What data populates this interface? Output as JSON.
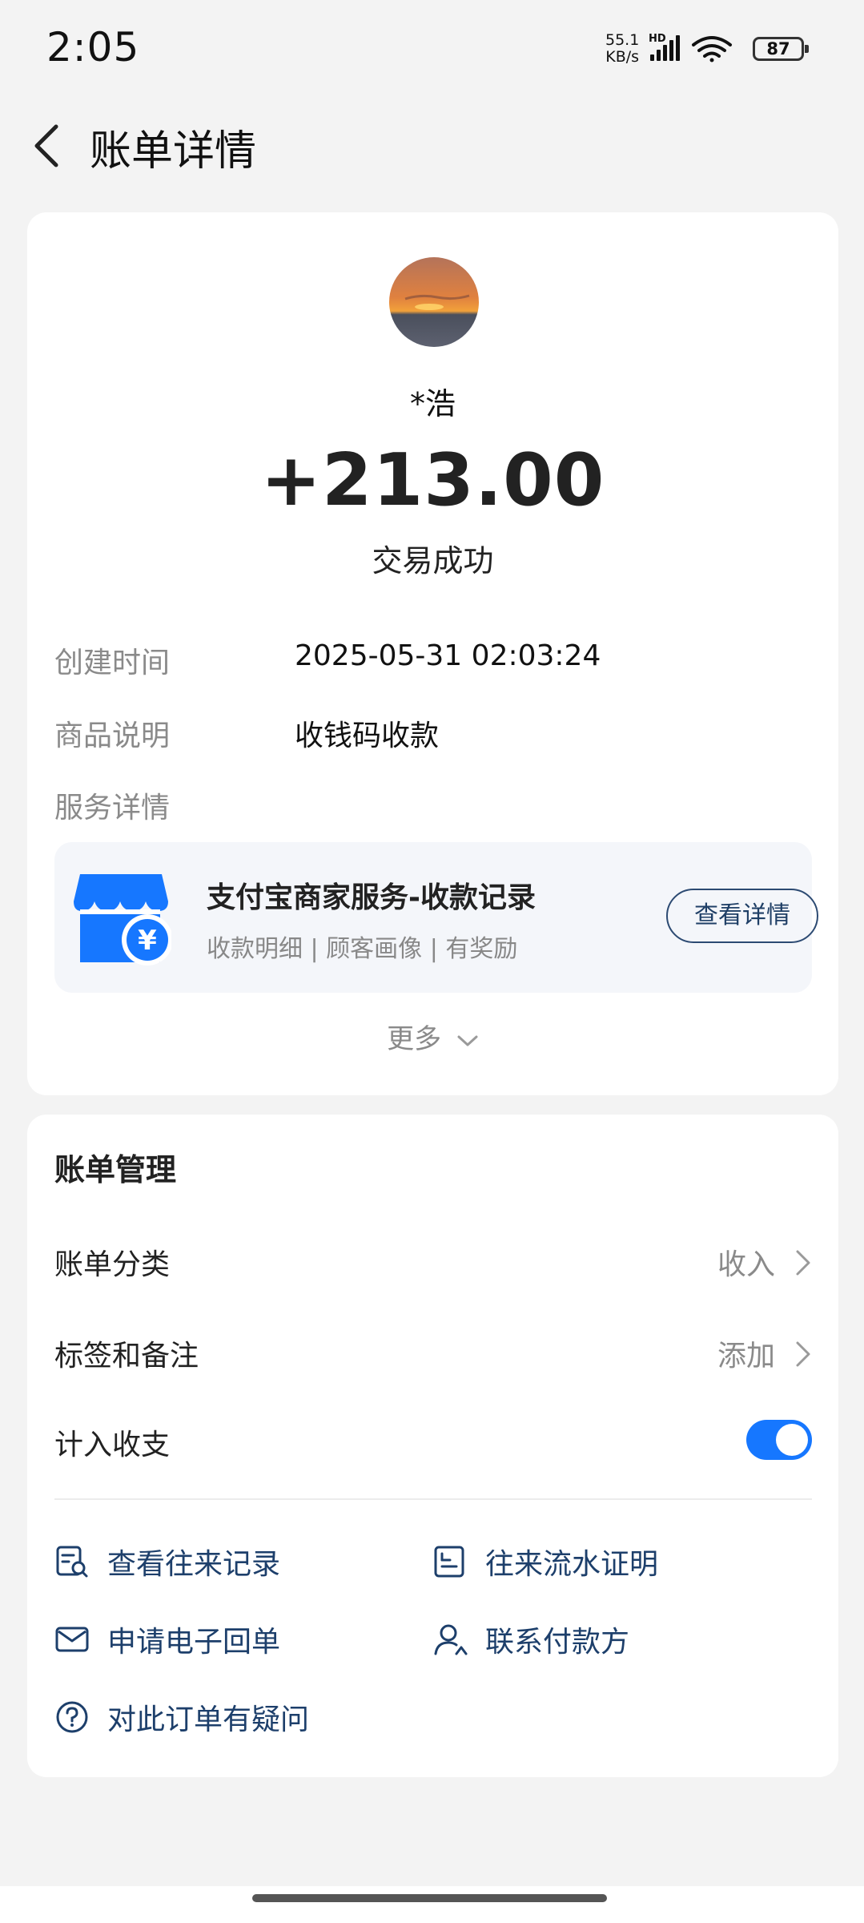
{
  "status_bar": {
    "time": "2:05",
    "net_speed_value": "55.1",
    "net_speed_unit": "KB/s",
    "network_badge": "HD",
    "battery_level": "87"
  },
  "header": {
    "title": "账单详情"
  },
  "transaction": {
    "payer_name": "*浩",
    "amount": "+213.00",
    "status": "交易成功"
  },
  "details": [
    {
      "label": "创建时间",
      "value": "2025-05-31 02:03:24"
    },
    {
      "label": "商品说明",
      "value": "收钱码收款"
    },
    {
      "label": "服务详情",
      "value": ""
    }
  ],
  "service": {
    "title": "支付宝商家服务-收款记录",
    "subtitle": "收款明细 | 顾客画像 | 有奖励",
    "button_label": "查看详情"
  },
  "more": {
    "label": "更多"
  },
  "bill_management": {
    "title": "账单管理",
    "category": {
      "label": "账单分类",
      "value": "收入"
    },
    "tags_notes": {
      "label": "标签和备注",
      "value": "添加"
    },
    "include_income_expense": {
      "label": "计入收支",
      "enabled": true
    }
  },
  "actions": {
    "view_records": "查看往来记录",
    "transaction_proof": "往来流水证明",
    "e_receipt": "申请电子回单",
    "contact_payer": "联系付款方",
    "order_question": "对此订单有疑问"
  },
  "colors": {
    "accent": "#1677ff",
    "link": "#1d3f6b",
    "background": "#f3f3f3",
    "muted_text": "#8a8a8a"
  }
}
